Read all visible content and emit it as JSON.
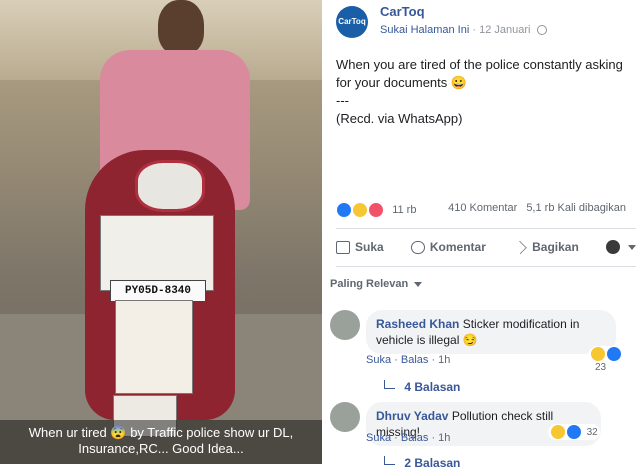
{
  "photo": {
    "plate_text": "PY05D-8340",
    "caption_line1": "When ur tired 😨 by Traffic  police show ur DL,",
    "caption_line2": "Insurance,RC... Good Idea..."
  },
  "post": {
    "page_name": "CarToq",
    "page_logo_text": "CarToq",
    "like_page": "Sukai Halaman Ini",
    "separator": "·",
    "date": "12 Januari",
    "text": "When you are tired of the police constantly asking for your documents 😀\n---\n(Recd. via WhatsApp)",
    "reaction_count": "11 rb",
    "comments_count": "410 Komentar",
    "shares_count": "5,1 rb Kali dibagikan"
  },
  "actions": {
    "like": "Suka",
    "comment": "Komentar",
    "share": "Bagikan"
  },
  "sort": {
    "label": "Paling Relevan"
  },
  "comments": [
    {
      "author": "Rasheed Khan",
      "text": "Sticker modification in vehicle is illegal 😏",
      "like": "Suka",
      "reply": "Balas",
      "time": "1h",
      "reactions": "23",
      "replies": "4 Balasan"
    },
    {
      "author": "Dhruv Yadav",
      "text": "Pollution check still missing!",
      "like": "Suka",
      "reply": "Balas",
      "time": "1h",
      "reactions": "32",
      "replies": "2 Balasan"
    }
  ],
  "colors": {
    "link": "#385898",
    "like_blue": "#2078f4"
  }
}
